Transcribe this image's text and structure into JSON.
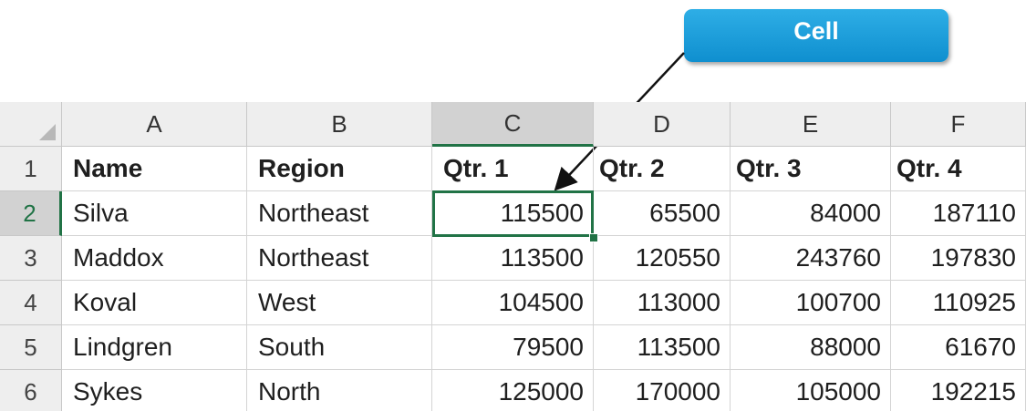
{
  "callout": {
    "label": "Cell"
  },
  "colors": {
    "accent_green": "#217346",
    "callout_blue": "#1a9fdc",
    "header_bg": "#eeeeee",
    "active_header_bg": "#d2d2d2"
  },
  "grid": {
    "corner_icon": "select-all-icon",
    "selected_cell": "C2",
    "columns": [
      "A",
      "B",
      "C",
      "D",
      "E",
      "F"
    ],
    "rows": [
      {
        "num": "1",
        "cells": [
          "Name",
          "Region",
          "Qtr. 1",
          "Qtr. 2",
          "Qtr. 3",
          "Qtr. 4"
        ]
      },
      {
        "num": "2",
        "cells": [
          "Silva",
          "Northeast",
          "115500",
          "65500",
          "84000",
          "187110"
        ]
      },
      {
        "num": "3",
        "cells": [
          "Maddox",
          "Northeast",
          "113500",
          "120550",
          "243760",
          "197830"
        ]
      },
      {
        "num": "4",
        "cells": [
          "Koval",
          "West",
          "104500",
          "113000",
          "100700",
          "110925"
        ]
      },
      {
        "num": "5",
        "cells": [
          "Lindgren",
          "South",
          "79500",
          "113500",
          "88000",
          "61670"
        ]
      },
      {
        "num": "6",
        "cells": [
          "Sykes",
          "North",
          "125000",
          "170000",
          "105000",
          "192215"
        ]
      }
    ]
  }
}
